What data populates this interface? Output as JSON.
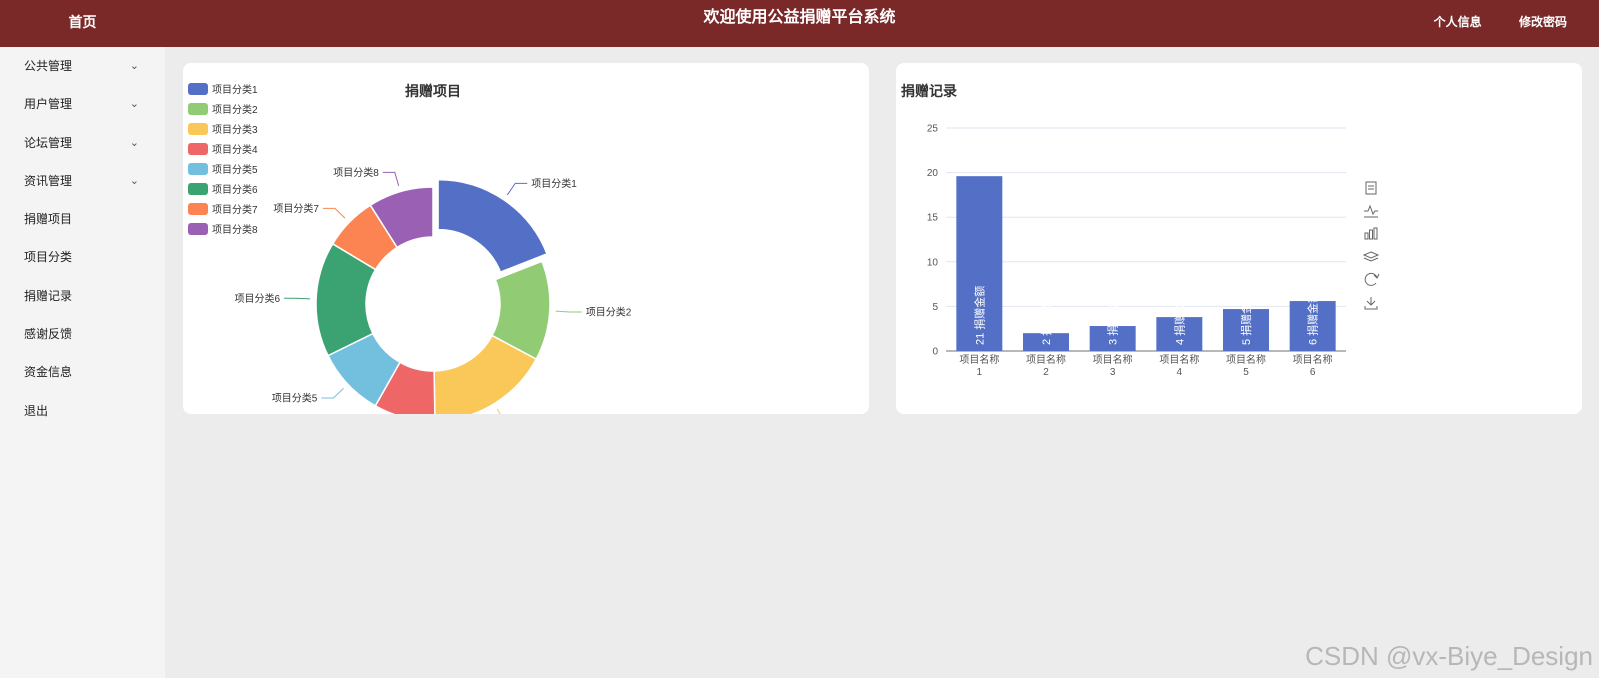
{
  "header": {
    "home_label": "首页",
    "title": "欢迎使用公益捐赠平台系统",
    "profile_label": "个人信息",
    "password_label": "修改密码"
  },
  "sidebar": {
    "items": [
      {
        "label": "公共管理",
        "expandable": true
      },
      {
        "label": "用户管理",
        "expandable": true
      },
      {
        "label": "论坛管理",
        "expandable": true
      },
      {
        "label": "资讯管理",
        "expandable": true
      },
      {
        "label": "捐赠项目",
        "expandable": false
      },
      {
        "label": "项目分类",
        "expandable": false
      },
      {
        "label": "捐赠记录",
        "expandable": false
      },
      {
        "label": "感谢反馈",
        "expandable": false
      },
      {
        "label": "资金信息",
        "expandable": false
      },
      {
        "label": "退出",
        "expandable": false
      }
    ]
  },
  "pie_card": {
    "title": "捐赠项目"
  },
  "bar_card": {
    "title": "捐赠记录"
  },
  "toolbox": [
    "data-view-icon",
    "line-chart-icon",
    "bar-chart-icon",
    "stack-icon",
    "restore-icon",
    "download-icon"
  ],
  "watermark": "CSDN @vx-Biye_Design",
  "chart_data": [
    {
      "type": "pie",
      "title": "捐赠项目",
      "donut": true,
      "legend_position": "top-left",
      "categories": [
        "项目分类1",
        "项目分类2",
        "项目分类3",
        "项目分类4",
        "项目分类5",
        "项目分类6",
        "项目分类7",
        "项目分类8"
      ],
      "values": [
        18,
        13,
        16,
        8,
        9,
        15,
        7,
        8.5
      ],
      "colors": [
        "#5470c6",
        "#91cc75",
        "#fac858",
        "#ee6666",
        "#73c0de",
        "#3ba272",
        "#fc8452",
        "#9a60b4"
      ],
      "exploded_index": 0
    },
    {
      "type": "bar",
      "title": "捐赠记录",
      "categories": [
        "项目名称1",
        "项目名称2",
        "项目名称3",
        "项目名称4",
        "项目名称5",
        "项目名称6"
      ],
      "values": [
        19.6,
        2,
        2.8,
        3.8,
        4.7,
        5.6
      ],
      "data_labels": [
        "21 捐赠金额",
        "2 捐赠金额",
        "3 捐赠金额",
        "4 捐赠金额",
        "5 捐赠金额",
        "6 捐赠金额"
      ],
      "ylim": [
        0,
        25
      ],
      "yticks": [
        0,
        5,
        10,
        15,
        20,
        25
      ],
      "grid": true,
      "color": "#5470c6"
    }
  ]
}
